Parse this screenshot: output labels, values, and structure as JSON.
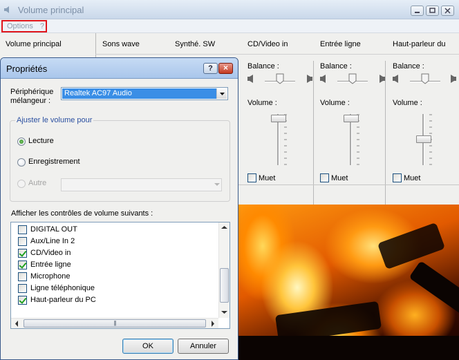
{
  "main_window": {
    "title": "Volume principal",
    "menu": {
      "options": "Options",
      "help": "?"
    },
    "first_column": "Volume principal",
    "columns": [
      {
        "name": "Sons wave"
      },
      {
        "name": "Synthé. SW"
      },
      {
        "name": "CD/Video in",
        "balance_label": "Balance :",
        "volume_label": "Volume :",
        "mute_label": "Muet",
        "volume_level": 1.0
      },
      {
        "name": "Entrée ligne",
        "balance_label": "Balance :",
        "volume_label": "Volume :",
        "mute_label": "Muet",
        "volume_level": 1.0
      },
      {
        "name": "Haut-parleur du",
        "balance_label": "Balance :",
        "volume_label": "Volume :",
        "mute_label": "Muet",
        "volume_level": 0.5
      }
    ]
  },
  "dialog": {
    "title": "Propriétés",
    "help_button": "?",
    "close_button": "×",
    "device_label_line1": "Périphérique",
    "device_label_line2": "mélangeur :",
    "device_value": "Realtek AC97 Audio",
    "group_title": "Ajuster le volume pour",
    "radios": [
      {
        "label": "Lecture",
        "checked": true,
        "enabled": true
      },
      {
        "label": "Enregistrement",
        "checked": false,
        "enabled": true
      },
      {
        "label": "Autre",
        "checked": false,
        "enabled": false
      }
    ],
    "show_label": "Afficher les contrôles de volume suivants :",
    "list_items": [
      {
        "label": "DIGITAL OUT",
        "checked": false
      },
      {
        "label": "Aux/Line In 2",
        "checked": false
      },
      {
        "label": "CD/Video in",
        "checked": true
      },
      {
        "label": "Entrée ligne",
        "checked": true
      },
      {
        "label": "Microphone",
        "checked": false
      },
      {
        "label": "Ligne téléphonique",
        "checked": false
      },
      {
        "label": "Haut-parleur du PC",
        "checked": true
      }
    ],
    "ok_button": "OK",
    "cancel_button": "Annuler"
  },
  "colors": {
    "highlight_border": "#e0141a",
    "selection": "#3a8ee6",
    "group_title": "#2a4fa0"
  },
  "background_image": "fire"
}
